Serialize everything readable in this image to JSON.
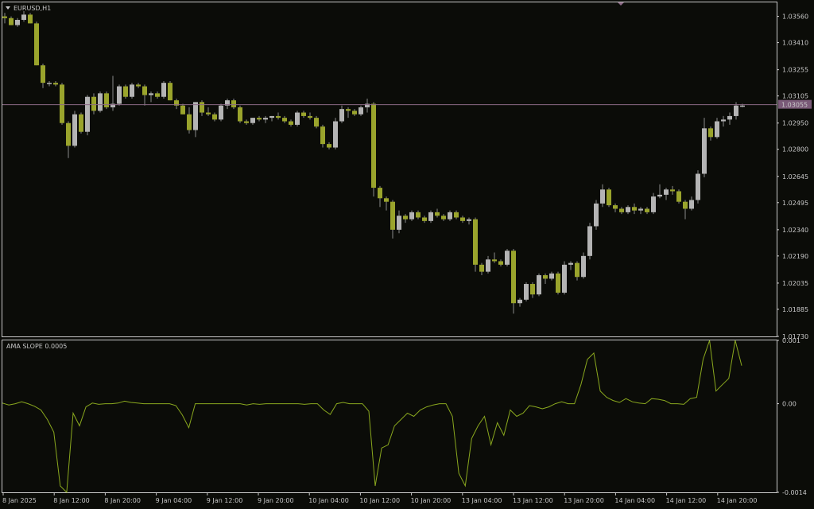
{
  "symbol_title": "EURUSD,H1",
  "indicator_title": "AMA SLOPE 0.0005",
  "current_price_label": "1.03055",
  "colors": {
    "background": "#0b0c08",
    "frame": "#c8c8c8",
    "bull": "#b4b4b4",
    "bear": "#9aa42c",
    "wick": "#8a8a8a",
    "bid_line": "#8c6a86",
    "indicator_line": "#8aa81e",
    "text": "#c8c8c8"
  },
  "price_axis": {
    "min": 1.0173,
    "max": 1.0364,
    "ticks": [
      "1.03560",
      "1.03410",
      "1.03255",
      "1.03105",
      "1.02950",
      "1.02800",
      "1.02645",
      "1.02495",
      "1.02340",
      "1.02190",
      "1.02035",
      "1.01885",
      "1.01730"
    ]
  },
  "indicator_axis": {
    "min": -0.0014,
    "max": 0.001,
    "ticks": [
      "0.001",
      "0.00",
      "-0.0014"
    ]
  },
  "time_axis": {
    "labels": [
      "8 Jan 2025",
      "8 Jan 12:00",
      "8 Jan 20:00",
      "9 Jan 04:00",
      "9 Jan 12:00",
      "9 Jan 20:00",
      "10 Jan 04:00",
      "10 Jan 12:00",
      "10 Jan 20:00",
      "13 Jan 04:00",
      "13 Jan 12:00",
      "13 Jan 20:00",
      "14 Jan 04:00",
      "14 Jan 12:00",
      "14 Jan 20:00"
    ]
  },
  "chart_data": [
    {
      "type": "candlestick",
      "title": "EURUSD,H1",
      "bid": 1.03055,
      "candles": [
        [
          1.0356,
          1.0358,
          1.0352,
          1.0355
        ],
        [
          1.0355,
          1.0356,
          1.0351,
          1.0351
        ],
        [
          1.0351,
          1.0355,
          1.035,
          1.0354
        ],
        [
          1.0354,
          1.0359,
          1.0353,
          1.0357
        ],
        [
          1.0357,
          1.0358,
          1.0352,
          1.0352
        ],
        [
          1.0352,
          1.0353,
          1.0328,
          1.0328
        ],
        [
          1.0328,
          1.0329,
          1.0315,
          1.0318
        ],
        [
          1.0318,
          1.0319,
          1.0316,
          1.0318
        ],
        [
          1.0318,
          1.0319,
          1.0316,
          1.0317
        ],
        [
          1.0317,
          1.0318,
          1.0294,
          1.0295
        ],
        [
          1.0295,
          1.0296,
          1.0275,
          1.0282
        ],
        [
          1.0282,
          1.0302,
          1.0281,
          1.03
        ],
        [
          1.03,
          1.0301,
          1.0289,
          1.029
        ],
        [
          1.029,
          1.0311,
          1.0288,
          1.031
        ],
        [
          1.031,
          1.0312,
          1.03,
          1.0302
        ],
        [
          1.0302,
          1.0313,
          1.0301,
          1.0312
        ],
        [
          1.0312,
          1.0313,
          1.0303,
          1.0304
        ],
        [
          1.0304,
          1.0322,
          1.0302,
          1.0306
        ],
        [
          1.0306,
          1.0317,
          1.0305,
          1.0316
        ],
        [
          1.0316,
          1.0317,
          1.0309,
          1.031
        ],
        [
          1.031,
          1.0318,
          1.0309,
          1.0317
        ],
        [
          1.0317,
          1.0318,
          1.0315,
          1.0316
        ],
        [
          1.0316,
          1.0317,
          1.0305,
          1.0311
        ],
        [
          1.0311,
          1.0313,
          1.0307,
          1.0312
        ],
        [
          1.0312,
          1.0313,
          1.0309,
          1.031
        ],
        [
          1.031,
          1.0319,
          1.0309,
          1.0318
        ],
        [
          1.0318,
          1.0319,
          1.0308,
          1.0308
        ],
        [
          1.0308,
          1.0309,
          1.0303,
          1.0305
        ],
        [
          1.0305,
          1.0306,
          1.03,
          1.03
        ],
        [
          1.03,
          1.0304,
          1.0289,
          1.0291
        ],
        [
          1.0291,
          1.0292,
          1.0287,
          1.0307
        ],
        [
          1.0307,
          1.0308,
          1.0299,
          1.0301
        ],
        [
          1.0301,
          1.0304,
          1.0299,
          1.03
        ],
        [
          1.03,
          1.0301,
          1.0296,
          1.0297
        ],
        [
          1.0297,
          1.0306,
          1.0296,
          1.0305
        ],
        [
          1.0305,
          1.0309,
          1.0303,
          1.0308
        ],
        [
          1.0308,
          1.0309,
          1.0303,
          1.0304
        ],
        [
          1.0304,
          1.0305,
          1.0295,
          1.0296
        ],
        [
          1.0296,
          1.0297,
          1.0294,
          1.0295
        ],
        [
          1.0295,
          1.0298,
          1.0294,
          1.0298
        ],
        [
          1.0298,
          1.0299,
          1.0296,
          1.0297
        ],
        [
          1.0297,
          1.0299,
          1.0295,
          1.0298
        ],
        [
          1.0298,
          1.0299,
          1.0296,
          1.0299
        ],
        [
          1.0299,
          1.0301,
          1.0297,
          1.0298
        ],
        [
          1.0298,
          1.0299,
          1.0295,
          1.0296
        ],
        [
          1.0296,
          1.0297,
          1.0293,
          1.0294
        ],
        [
          1.0294,
          1.0302,
          1.0293,
          1.0301
        ],
        [
          1.0301,
          1.0302,
          1.0298,
          1.0299
        ],
        [
          1.0299,
          1.0301,
          1.0297,
          1.0298
        ],
        [
          1.0298,
          1.0299,
          1.0292,
          1.0293
        ],
        [
          1.0293,
          1.0294,
          1.0281,
          1.0283
        ],
        [
          1.0283,
          1.0284,
          1.028,
          1.0281
        ],
        [
          1.0281,
          1.0298,
          1.028,
          1.0296
        ],
        [
          1.0296,
          1.0305,
          1.0295,
          1.0303
        ],
        [
          1.0303,
          1.0304,
          1.0298,
          1.0302
        ],
        [
          1.0302,
          1.0303,
          1.0299,
          1.03
        ],
        [
          1.03,
          1.0305,
          1.0299,
          1.0304
        ],
        [
          1.0304,
          1.0309,
          1.0301,
          1.0306
        ],
        [
          1.0306,
          1.0307,
          1.0253,
          1.0258
        ],
        [
          1.0258,
          1.0259,
          1.0247,
          1.0252
        ],
        [
          1.0252,
          1.0253,
          1.0245,
          1.025
        ],
        [
          1.025,
          1.0251,
          1.0229,
          1.0234
        ],
        [
          1.0234,
          1.0245,
          1.0232,
          1.0242
        ],
        [
          1.0242,
          1.0243,
          1.0238,
          1.024
        ],
        [
          1.024,
          1.0245,
          1.0239,
          1.0244
        ],
        [
          1.0244,
          1.0245,
          1.024,
          1.0241
        ],
        [
          1.0241,
          1.0242,
          1.0238,
          1.0239
        ],
        [
          1.0239,
          1.0245,
          1.0238,
          1.0244
        ],
        [
          1.0244,
          1.0246,
          1.0241,
          1.0242
        ],
        [
          1.0242,
          1.0243,
          1.0239,
          1.024
        ],
        [
          1.024,
          1.0245,
          1.0239,
          1.0244
        ],
        [
          1.0244,
          1.0245,
          1.024,
          1.0241
        ],
        [
          1.0241,
          1.0242,
          1.0238,
          1.0239
        ],
        [
          1.0239,
          1.0241,
          1.0237,
          1.024
        ],
        [
          1.024,
          1.0241,
          1.021,
          1.0214
        ],
        [
          1.0214,
          1.0215,
          1.0208,
          1.021
        ],
        [
          1.021,
          1.0219,
          1.0209,
          1.0217
        ],
        [
          1.0217,
          1.0221,
          1.0215,
          1.0216
        ],
        [
          1.0216,
          1.0217,
          1.0213,
          1.0214
        ],
        [
          1.0214,
          1.0223,
          1.0213,
          1.0222
        ],
        [
          1.0222,
          1.0223,
          1.0186,
          1.0192
        ],
        [
          1.0192,
          1.0195,
          1.019,
          1.0194
        ],
        [
          1.0194,
          1.0204,
          1.0193,
          1.0203
        ],
        [
          1.0203,
          1.0204,
          1.0195,
          1.0197
        ],
        [
          1.0197,
          1.0209,
          1.0196,
          1.0208
        ],
        [
          1.0208,
          1.0209,
          1.0203,
          1.0206
        ],
        [
          1.0206,
          1.021,
          1.0205,
          1.0209
        ],
        [
          1.0209,
          1.021,
          1.0197,
          1.0198
        ],
        [
          1.0198,
          1.0216,
          1.0197,
          1.0214
        ],
        [
          1.0214,
          1.0216,
          1.0211,
          1.0215
        ],
        [
          1.0215,
          1.0216,
          1.0205,
          1.0207
        ],
        [
          1.0207,
          1.0221,
          1.0206,
          1.0219
        ],
        [
          1.0219,
          1.0238,
          1.0217,
          1.0236
        ],
        [
          1.0236,
          1.0251,
          1.0234,
          1.0249
        ],
        [
          1.0249,
          1.026,
          1.0247,
          1.0257
        ],
        [
          1.0257,
          1.0258,
          1.0247,
          1.0248
        ],
        [
          1.0248,
          1.0249,
          1.0244,
          1.0246
        ],
        [
          1.0246,
          1.0247,
          1.0243,
          1.0244
        ],
        [
          1.0244,
          1.0248,
          1.0243,
          1.0247
        ],
        [
          1.0247,
          1.0249,
          1.0243,
          1.0245
        ],
        [
          1.0245,
          1.0247,
          1.0243,
          1.0246
        ],
        [
          1.0246,
          1.0247,
          1.0243,
          1.0244
        ],
        [
          1.0244,
          1.0255,
          1.0243,
          1.0253
        ],
        [
          1.0253,
          1.026,
          1.0252,
          1.0254
        ],
        [
          1.0254,
          1.0258,
          1.0251,
          1.0257
        ],
        [
          1.0257,
          1.0259,
          1.0254,
          1.0256
        ],
        [
          1.0256,
          1.0257,
          1.0249,
          1.025
        ],
        [
          1.025,
          1.0251,
          1.024,
          1.0246
        ],
        [
          1.0246,
          1.0253,
          1.0245,
          1.0251
        ],
        [
          1.0251,
          1.0268,
          1.0249,
          1.0266
        ],
        [
          1.0266,
          1.0298,
          1.0264,
          1.0292
        ],
        [
          1.0292,
          1.0293,
          1.0285,
          1.0287
        ],
        [
          1.0287,
          1.0298,
          1.0286,
          1.0296
        ],
        [
          1.0296,
          1.0299,
          1.0293,
          1.0297
        ],
        [
          1.0297,
          1.0301,
          1.0294,
          1.0299
        ],
        [
          1.0299,
          1.0307,
          1.0297,
          1.0305
        ],
        [
          1.0305,
          1.0306,
          1.0304,
          1.0305
        ]
      ]
    },
    {
      "type": "line",
      "title": "AMA SLOPE 0.0005",
      "ylim": [
        -0.0014,
        0.001
      ],
      "series": [
        {
          "values": [
            1e-05,
            -2e-05,
            0.0,
            3e-05,
            0.0,
            -4e-05,
            -0.0001,
            -0.00025,
            -0.00045,
            -0.0013,
            -0.0014,
            -0.00015,
            -0.00035,
            -5e-05,
            1e-05,
            -1e-05,
            0.0,
            0.0,
            1e-05,
            4e-05,
            2e-05,
            1e-05,
            0.0,
            0.0,
            0.0,
            0.0,
            0.0,
            -3e-05,
            -0.00018,
            -0.00038,
            0.0,
            0.0,
            0.0,
            0.0,
            0.0,
            0.0,
            0.0,
            0.0,
            -2e-05,
            0.0,
            -1e-05,
            0.0,
            0.0,
            0.0,
            0.0,
            0.0,
            0.0,
            -1e-05,
            0.0,
            0.0,
            -0.0001,
            -0.00017,
            0.0,
            2e-05,
            0.0,
            0.0,
            0.0,
            -0.00012,
            -0.0013,
            -0.0007,
            -0.00065,
            -0.00035,
            -0.00025,
            -0.00015,
            -0.0002,
            -0.0001,
            -5e-05,
            -2e-05,
            0.0,
            0.0,
            -0.0002,
            -0.0011,
            -0.0013,
            -0.00055,
            -0.00035,
            -0.0002,
            -0.00065,
            -0.0003,
            -0.0005,
            -0.0001,
            -0.0002,
            -0.00015,
            -3e-05,
            -5e-05,
            -8e-05,
            -5e-05,
            0.0,
            3e-05,
            0.0,
            0.0,
            0.0003,
            0.0007,
            0.0008,
            0.0002,
            0.0001,
            5e-05,
            2e-05,
            8e-05,
            3e-05,
            1e-05,
            0.0,
            8e-05,
            7e-05,
            5e-05,
            0.0,
            0.0,
            -1e-05,
            8e-05,
            0.0001,
            0.0007,
            0.001,
            0.0002,
            0.0003,
            0.0004,
            0.001,
            0.0006
          ]
        }
      ]
    }
  ]
}
